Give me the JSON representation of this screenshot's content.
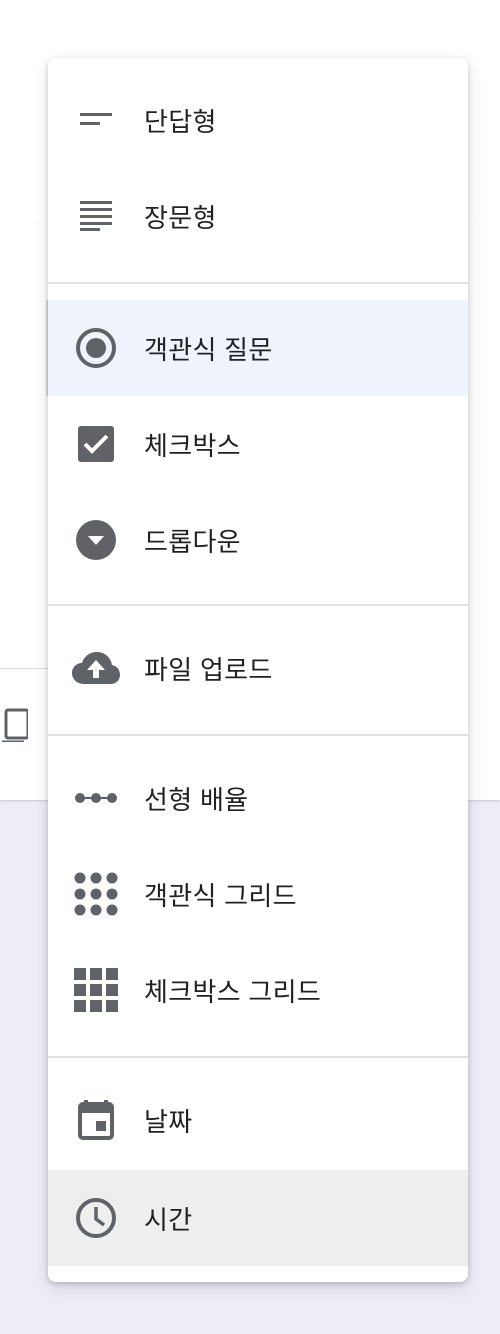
{
  "menu": {
    "items": [
      {
        "label": "단답형",
        "icon": "short-answer-icon"
      },
      {
        "label": "장문형",
        "icon": "paragraph-icon"
      },
      {
        "label": "객관식 질문",
        "icon": "radio-button-icon"
      },
      {
        "label": "체크박스",
        "icon": "checkbox-icon"
      },
      {
        "label": "드롭다운",
        "icon": "dropdown-icon"
      },
      {
        "label": "파일 업로드",
        "icon": "cloud-upload-icon"
      },
      {
        "label": "선형 배율",
        "icon": "linear-scale-icon"
      },
      {
        "label": "객관식 그리드",
        "icon": "dot-grid-icon"
      },
      {
        "label": "체크박스 그리드",
        "icon": "square-grid-icon"
      },
      {
        "label": "날짜",
        "icon": "calendar-icon"
      },
      {
        "label": "시간",
        "icon": "clock-icon"
      }
    ],
    "selected_label": "객관식 질문",
    "hovered_label": "시간"
  },
  "colors": {
    "icon": "#5f6368",
    "text": "#202124",
    "selected_bg": "#eef3fc",
    "hover_bg": "#eeeeee",
    "page_bg": "#efebf7"
  }
}
